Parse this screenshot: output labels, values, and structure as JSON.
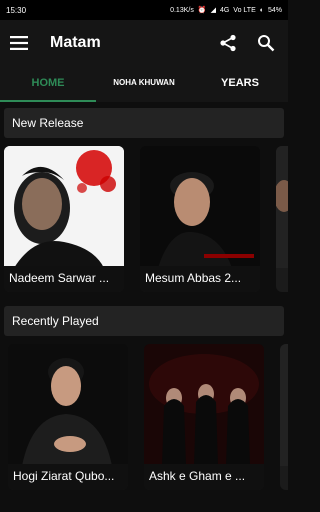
{
  "status_bar": {
    "time": "15:30",
    "speed": "0.13K/s",
    "network": "4G",
    "volte": "Vo LTE",
    "battery": "54%"
  },
  "app_bar": {
    "title": "Matam",
    "icons": [
      "menu-icon",
      "share-icon",
      "search-icon"
    ]
  },
  "tabs": [
    {
      "label": "HOME",
      "active": true
    },
    {
      "label": "NOHA KHUWAN",
      "active": false
    },
    {
      "label": "YEARS",
      "active": false
    }
  ],
  "sections": [
    {
      "title": "New Release",
      "cards": [
        {
          "title": "Nadeem Sarwar ..."
        },
        {
          "title": "Mesum Abbas 2..."
        }
      ]
    },
    {
      "title": "Recently Played",
      "cards": [
        {
          "title": "Hogi Ziarat Qubo..."
        },
        {
          "title": "Ashk e Gham e ..."
        }
      ]
    }
  ],
  "colors": {
    "accent": "#2e8b57",
    "background": "#0e0e0e",
    "app_bar": "#151515"
  }
}
